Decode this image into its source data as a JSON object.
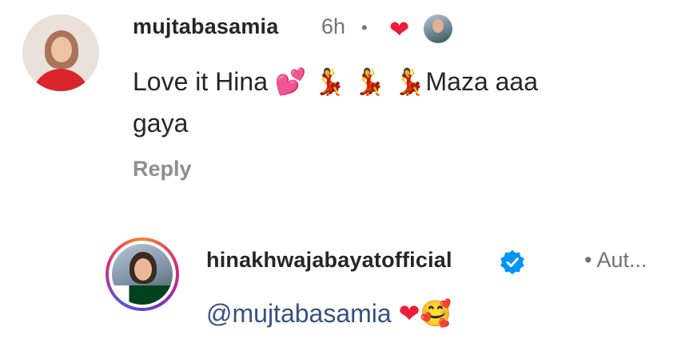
{
  "comment": {
    "username": "mujtabasamia",
    "time": "6h",
    "separator": "•",
    "text_before": "Love it Hina ",
    "text_emojis_1": "💕",
    "text_emojis_2": "💃 💃 💃",
    "text_after": "Maza aaa",
    "text_line2": "gaya",
    "reply_label": "Reply",
    "liked_by_creator": "❤"
  },
  "reply": {
    "username": "hinakhwajabayatofficial",
    "verified_icon": "verified-badge-icon",
    "meta": "• Aut...",
    "mention": "@mujtabasamia",
    "emoji_heart": "❤",
    "emoji_face": "🥰"
  },
  "colors": {
    "username": "#262626",
    "meta": "#737373",
    "mention": "#385185",
    "heart": "#ed1c3a",
    "verified": "#0095f6"
  }
}
